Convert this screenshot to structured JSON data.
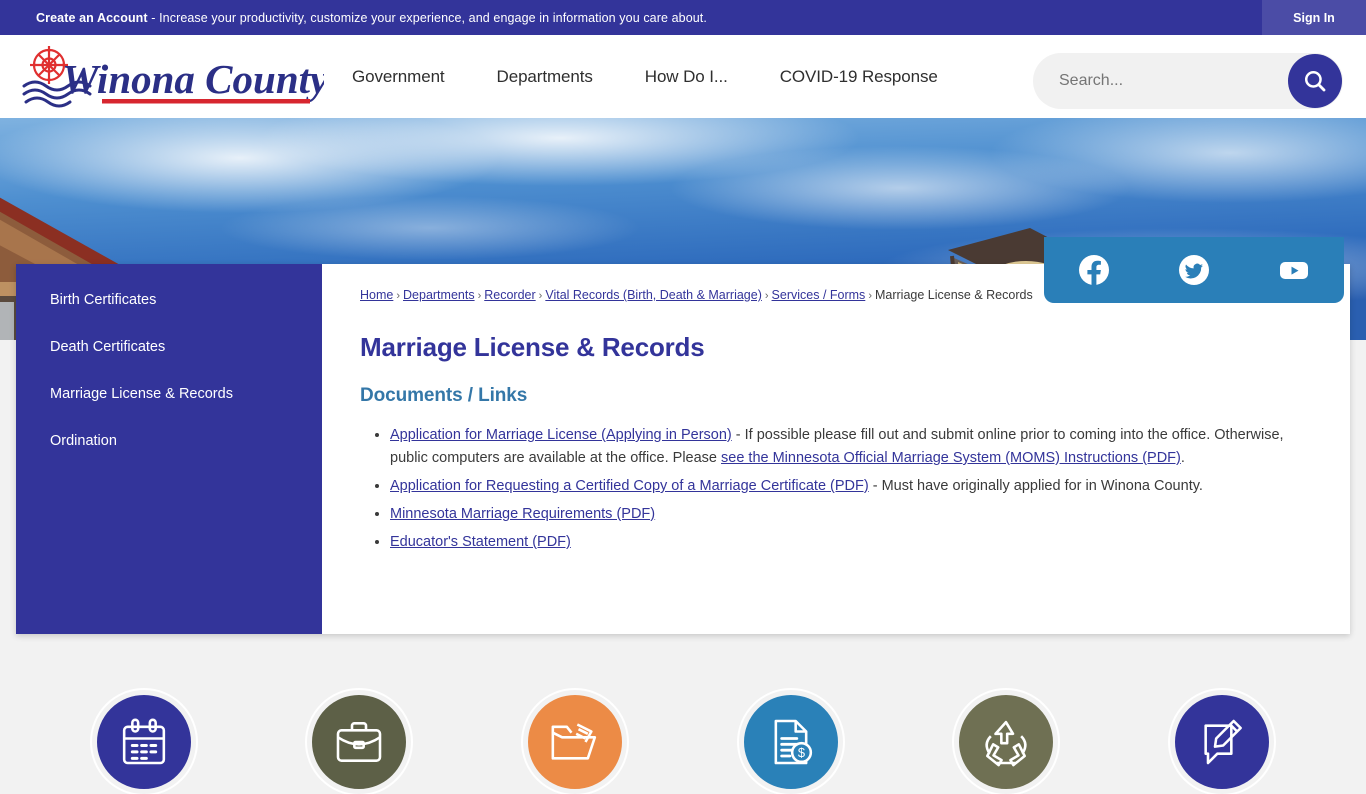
{
  "topbar": {
    "promo_strong": "Create an Account",
    "promo_rest": " - Increase your productivity, customize your experience, and engage in information you care about.",
    "signin_label": "Sign In"
  },
  "header": {
    "logo_text": "Winona County",
    "nav": [
      {
        "label": "Government"
      },
      {
        "label": "Departments"
      },
      {
        "label": "How Do I..."
      },
      {
        "label": "COVID-19 Response"
      }
    ],
    "search": {
      "placeholder": "Search...",
      "value": "",
      "button_icon": "search-icon"
    }
  },
  "hero": {
    "social": [
      {
        "name": "facebook-icon",
        "label": "Facebook"
      },
      {
        "name": "twitter-icon",
        "label": "Twitter"
      },
      {
        "name": "youtube-icon",
        "label": "YouTube"
      }
    ]
  },
  "sidebar": {
    "items": [
      {
        "label": "Birth Certificates"
      },
      {
        "label": "Death Certificates"
      },
      {
        "label": "Marriage License & Records"
      },
      {
        "label": "Ordination"
      }
    ]
  },
  "breadcrumb": {
    "links": [
      {
        "label": "Home"
      },
      {
        "label": "Departments"
      },
      {
        "label": "Recorder"
      },
      {
        "label": "Vital Records (Birth, Death & Marriage)"
      },
      {
        "label": "Services / Forms"
      }
    ],
    "current": "Marriage License & Records",
    "separator": "›"
  },
  "main": {
    "page_title": "Marriage License & Records",
    "section_title": "Documents / Links",
    "documents": [
      {
        "link": "Application for Marriage License (Applying in Person)",
        "text_after": " - If possible please fill out and submit online prior to coming into the office. Otherwise, public computers are available at the office. Please ",
        "link2": "see the Minnesota Official Marriage System (MOMS) Instructions (PDF)",
        "tail": "."
      },
      {
        "link": "Application for Requesting a Certified Copy of a Marriage Certificate (PDF)",
        "text_after": " - Must have originally applied for in Winona County.",
        "link2": "",
        "tail": ""
      },
      {
        "link": "Minnesota Marriage Requirements (PDF)",
        "text_after": "",
        "link2": "",
        "tail": ""
      },
      {
        "link": "Educator's Statement (PDF)",
        "text_after": "",
        "link2": "",
        "tail": ""
      }
    ]
  },
  "quicklinks": [
    {
      "name": "calendar-icon",
      "color": "#33349a"
    },
    {
      "name": "briefcase-icon",
      "color": "#5d6047"
    },
    {
      "name": "folder-icon",
      "color": "#ec8b46"
    },
    {
      "name": "invoice-icon",
      "color": "#2a81b8"
    },
    {
      "name": "recycle-icon",
      "color": "#6f7053"
    },
    {
      "name": "report-icon",
      "color": "#33349a"
    }
  ],
  "colors": {
    "brand_indigo": "#33349a",
    "brand_red": "#d7262f",
    "accent_teal": "#3477a8",
    "social_blue": "#2a7fb8",
    "footer_bg": "#f2f2f2"
  }
}
